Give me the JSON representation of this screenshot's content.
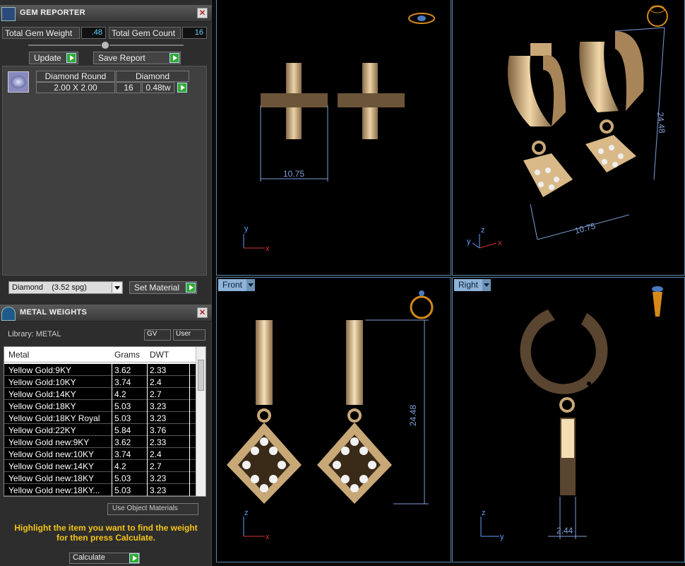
{
  "gem_reporter": {
    "title": "GEM REPORTER",
    "total_weight_label": "Total Gem Weight",
    "total_weight_value": ".48",
    "total_count_label": "Total Gem Count",
    "total_count_value": "16",
    "update_label": "Update",
    "save_report_label": "Save Report",
    "gem_row": {
      "name": "Diamond Round",
      "material": "Diamond",
      "size": "2.00 X 2.00",
      "count": "16",
      "weight": "0.48tw"
    },
    "material_select": "Diamond    (3.52 spg)",
    "set_material_label": "Set Material"
  },
  "metal_weights": {
    "title": "METAL WEIGHTS",
    "library_label": "Library: METAL",
    "gv_label": "GV",
    "user_label": "User",
    "columns": [
      "Metal",
      "Grams",
      "DWT"
    ],
    "rows": [
      {
        "metal": "Yellow Gold:9KY",
        "grams": "3.62",
        "dwt": "2.33"
      },
      {
        "metal": "Yellow Gold:10KY",
        "grams": "3.74",
        "dwt": "2.4"
      },
      {
        "metal": "Yellow Gold:14KY",
        "grams": "4.2",
        "dwt": "2.7"
      },
      {
        "metal": "Yellow Gold:18KY",
        "grams": "5.03",
        "dwt": "3.23"
      },
      {
        "metal": "Yellow Gold:18KY Royal",
        "grams": "5.03",
        "dwt": "3.23"
      },
      {
        "metal": "Yellow Gold:22KY",
        "grams": "5.84",
        "dwt": "3.76"
      },
      {
        "metal": "Yellow Gold new:9KY",
        "grams": "3.62",
        "dwt": "2.33"
      },
      {
        "metal": "Yellow Gold new:10KY",
        "grams": "3.74",
        "dwt": "2.4"
      },
      {
        "metal": "Yellow Gold new:14KY",
        "grams": "4.2",
        "dwt": "2.7"
      },
      {
        "metal": "Yellow Gold new:18KY",
        "grams": "5.03",
        "dwt": "3.23"
      },
      {
        "metal": "Yellow Gold new:18KY...",
        "grams": "5.03",
        "dwt": "3.23"
      }
    ],
    "use_object_materials_label": "Use Object Materials",
    "hint_line1": "Highlight the item you want to find the weight",
    "hint_line2": "for then press Calculate.",
    "calculate_label": "Calculate"
  },
  "viewports": {
    "top": {
      "dim_width": "10.75",
      "axis_y": "y",
      "axis_x": "x"
    },
    "perspective": {
      "dim_height": "24.48",
      "dim_width": "10.75",
      "axis_y": "y",
      "axis_z": "z",
      "axis_x": "x"
    },
    "front": {
      "tab": "Front",
      "dim_height": "24.48",
      "axis_z": "z",
      "axis_x": "x"
    },
    "right": {
      "tab": "Right",
      "dim_thickness": "2.44",
      "axis_z": "z",
      "axis_y": "y"
    }
  },
  "colors": {
    "gold": "#c9a877",
    "dimension_line": "#7f9fd8",
    "hint_text": "#f5c518",
    "viewport_border": "#5a86a8"
  }
}
